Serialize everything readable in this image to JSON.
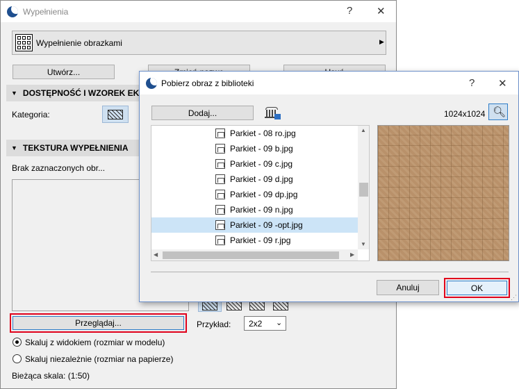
{
  "back_window": {
    "title": "Wypełnienia",
    "help_glyph": "?",
    "close_glyph": "✕",
    "fill_type": "Wypełnienie obrazkami",
    "create_button": "Utwórz...",
    "rename_button": "Zmień nazwę",
    "delete_button": "Usuń",
    "section_availability": "DOSTĘPNOŚĆ I WZOREK EKRAN",
    "category_label": "Kategoria:",
    "section_texture": "TEKSTURA WYPEŁNIENIA",
    "no_selection_text": "Brak zaznaczonych obr...",
    "browse_button": "Przeglądaj...",
    "example_label": "Przykład:",
    "example_value": "2x2",
    "radio_scale_view": "Skaluj z widokiem (rozmiar w modelu)",
    "radio_scale_independent": "Skaluj niezależnie (rozmiar na papierze)",
    "current_scale": "Bieżąca skala: (1:50)"
  },
  "dialog": {
    "title": "Pobierz obraz z biblioteki",
    "help_glyph": "?",
    "close_glyph": "✕",
    "add_button": "Dodaj...",
    "image_size": "1024x1024",
    "files": [
      {
        "name": "Parkiet - 08 ro.jpg",
        "selected": false
      },
      {
        "name": "Parkiet - 09 b.jpg",
        "selected": false
      },
      {
        "name": "Parkiet - 09 c.jpg",
        "selected": false
      },
      {
        "name": "Parkiet - 09 d.jpg",
        "selected": false
      },
      {
        "name": "Parkiet - 09 dp.jpg",
        "selected": false
      },
      {
        "name": "Parkiet - 09 n.jpg",
        "selected": false
      },
      {
        "name": "Parkiet - 09 -opt.jpg",
        "selected": true
      },
      {
        "name": "Parkiet - 09 r.jpg",
        "selected": false
      }
    ],
    "cancel_button": "Anuluj",
    "ok_button": "OK"
  },
  "colors": {
    "highlight": "#e0001b",
    "selection": "#cce4f7",
    "logo": "#1f4f8f"
  }
}
